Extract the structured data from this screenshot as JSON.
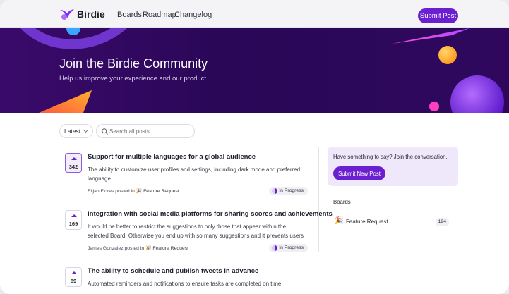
{
  "header": {
    "brand": "Birdie",
    "nav": [
      "Boards",
      "Roadmap",
      "Changelog"
    ],
    "submit_label": "Submit Post"
  },
  "hero": {
    "title": "Join the Birdie Community",
    "subtitle": "Help us improve your experience and our product"
  },
  "toolbar": {
    "sort_value": "Latest",
    "search_placeholder": "Search all posts..."
  },
  "posts": [
    {
      "votes": "342",
      "voted": true,
      "title": "Support for multiple languages for a global audience",
      "description": "The ability to customize user profiles and settings, including dark mode and preferred language.",
      "author": "Elijah Flores",
      "posted_in": "posted in",
      "board": "Feature Request",
      "status": "In Progress"
    },
    {
      "votes": "169",
      "voted": false,
      "title": "Integration with social media platforms for sharing scores and achievements",
      "description": "It would be better to restrict the suggestions to only those that appear within the selected Board.  Otherwise you end up with so many suggestions and it prevents users from looking t...",
      "author": "James Gonzalez",
      "posted_in": "posted in",
      "board": "Feature Request",
      "status": "In Progress"
    },
    {
      "votes": "89",
      "voted": false,
      "title": "The ability to schedule and publish tweets in advance",
      "description": "Automated reminders and notifications to ensure tasks are completed on time.",
      "author": "",
      "posted_in": "",
      "board": "",
      "status": ""
    }
  ],
  "sidebar": {
    "cta_text": "Have something to say? Join the conversation.",
    "cta_button": "Submit New Post",
    "boards_title": "Boards",
    "boards": [
      {
        "name": "Feature Request",
        "count": "194",
        "icon": "party-popper-icon"
      }
    ]
  },
  "colors": {
    "accent": "#6a1fd1",
    "hero_bg": "#2a0757"
  }
}
